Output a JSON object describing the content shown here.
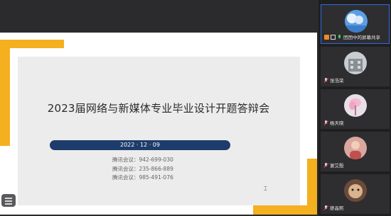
{
  "slide": {
    "title": "2023届网络与新媒体专业毕业设计开题答辩会",
    "date": "2022 · 12 · 09",
    "meetings": [
      "腾讯会议：942-699-030",
      "腾讯会议：235-866-889",
      "腾讯会议：985-491-076"
    ]
  },
  "participants": [
    {
      "name": "团团中的屏幕共享",
      "status": "sharing-screen"
    },
    {
      "name": "张浩荣",
      "status": "muted"
    },
    {
      "name": "杨天晓",
      "status": "muted"
    },
    {
      "name": "谢艾殷",
      "status": "muted"
    },
    {
      "name": "廖晶熙",
      "status": "muted"
    }
  ],
  "colors": {
    "accent": "#f5b01f",
    "date_pill": "#1d3c6b",
    "active_border": "#2f6bd8"
  }
}
